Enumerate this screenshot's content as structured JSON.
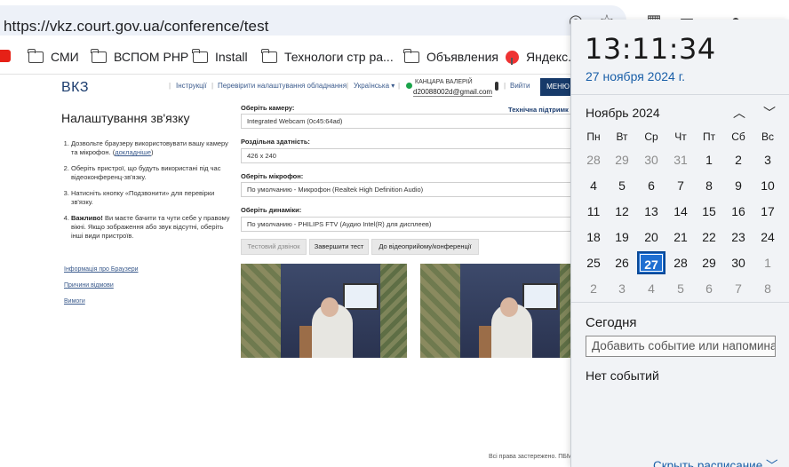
{
  "browser": {
    "url": "https://vkz.court.gov.ua/conference/test",
    "bookmarks": [
      "СМИ",
      "ВСПОМ PHP",
      "Install",
      "Технологи стр ра...",
      "Объявления",
      "Яндекс.П"
    ]
  },
  "site": {
    "logo": "ВКЗ",
    "nav": [
      "Інструкції",
      "Перевірити налаштування обладнання",
      "Українська ▾"
    ],
    "user_name": "КАНЦАРА ВАЛЕРІЙ",
    "user_email": "d20088002d@gmail.com",
    "logout": "Вийти",
    "menu": "МЕНЮ",
    "tech_support": "Технічна підтримк",
    "settings_title": "Налаштування зв'язку",
    "steps": {
      "s1": "Дозвольте браузеру використовувати вашу камеру та мікрофон. (",
      "s1_link": "докладніше",
      "s1_end": ")",
      "s2": "Оберіть пристрої, що будуть використані під час відеоконференц-зв'язку.",
      "s3": "Натисніть кнопку «Подзвонити» для перевірки зв'язку.",
      "s4_bold": "Важливо!",
      "s4": " Ви маєте бачити та чути себе у правому вікні. Якщо зображення або звук відсутні, оберіть інші види пристроїв."
    },
    "side_links": [
      "Інформація про Браузери",
      "Причини відмови",
      "Вимоги"
    ],
    "camera_label": "Оберіть камеру:",
    "camera_value": "Integrated Webcam (0c45:64ad)",
    "resolution_label": "Роздільна здатність:",
    "resolution_value": "426 x 240",
    "mic_label": "Оберіть мікрофон:",
    "mic_value": "По умолчанию - Микрофон (Realtek High Definition Audio)",
    "speaker_label": "Оберіть динаміки:",
    "speaker_value": "По умолчанию - PHILIPS FTV (Аудио Intel(R) для дисплеев)",
    "buttons": [
      "Тестовий дзвінок",
      "Завершити тест",
      "До відеоприйому/конференції"
    ],
    "footer": "Всі права застережено. ПБМ v"
  },
  "calendar": {
    "time": "13:11:34",
    "date": "27 ноября 2024 г.",
    "month": "Ноябрь 2024",
    "weekdays": [
      "Пн",
      "Вт",
      "Ср",
      "Чт",
      "Пт",
      "Сб",
      "Вс"
    ],
    "days": [
      [
        "28",
        "29",
        "30",
        "31",
        "1",
        "2",
        "3"
      ],
      [
        "4",
        "5",
        "6",
        "7",
        "8",
        "9",
        "10"
      ],
      [
        "11",
        "12",
        "13",
        "14",
        "15",
        "16",
        "17"
      ],
      [
        "18",
        "19",
        "20",
        "21",
        "22",
        "23",
        "24"
      ],
      [
        "25",
        "26",
        "27",
        "28",
        "29",
        "30",
        "1"
      ],
      [
        "2",
        "3",
        "4",
        "5",
        "6",
        "7",
        "8"
      ]
    ],
    "today_label": "Сегодня",
    "event_placeholder": "Добавить событие или напомина",
    "no_events": "Нет событий",
    "hide_schedule": "Скрыть расписание"
  }
}
